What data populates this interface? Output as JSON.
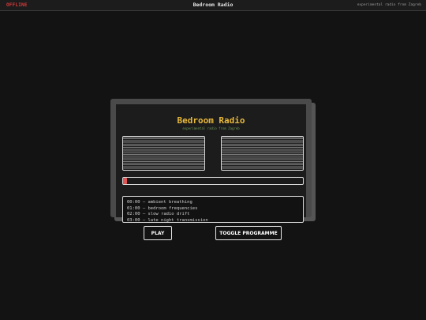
{
  "header": {
    "status": "OFFLINE",
    "title": "Bedroom Radio",
    "tagline": "experimental radio from Zagreb"
  },
  "radio": {
    "title": "Bedroom Radio",
    "subtitle": "experimental radio from Zagreb",
    "progress_percent": 2,
    "programme": [
      "00:00 — ambient breathing",
      "01:00 — bedroom frequencies",
      "02:00 — slow radio drift",
      "03:00 — late night transmission"
    ]
  },
  "controls": {
    "play_label": "PLAY",
    "toggle_label": "TOGGLE PROGRAMME"
  },
  "colors": {
    "status": "#d93a3a",
    "title_accent": "#e8b93a",
    "subtitle_accent": "#6f9a5a",
    "progress": "#e05555"
  }
}
